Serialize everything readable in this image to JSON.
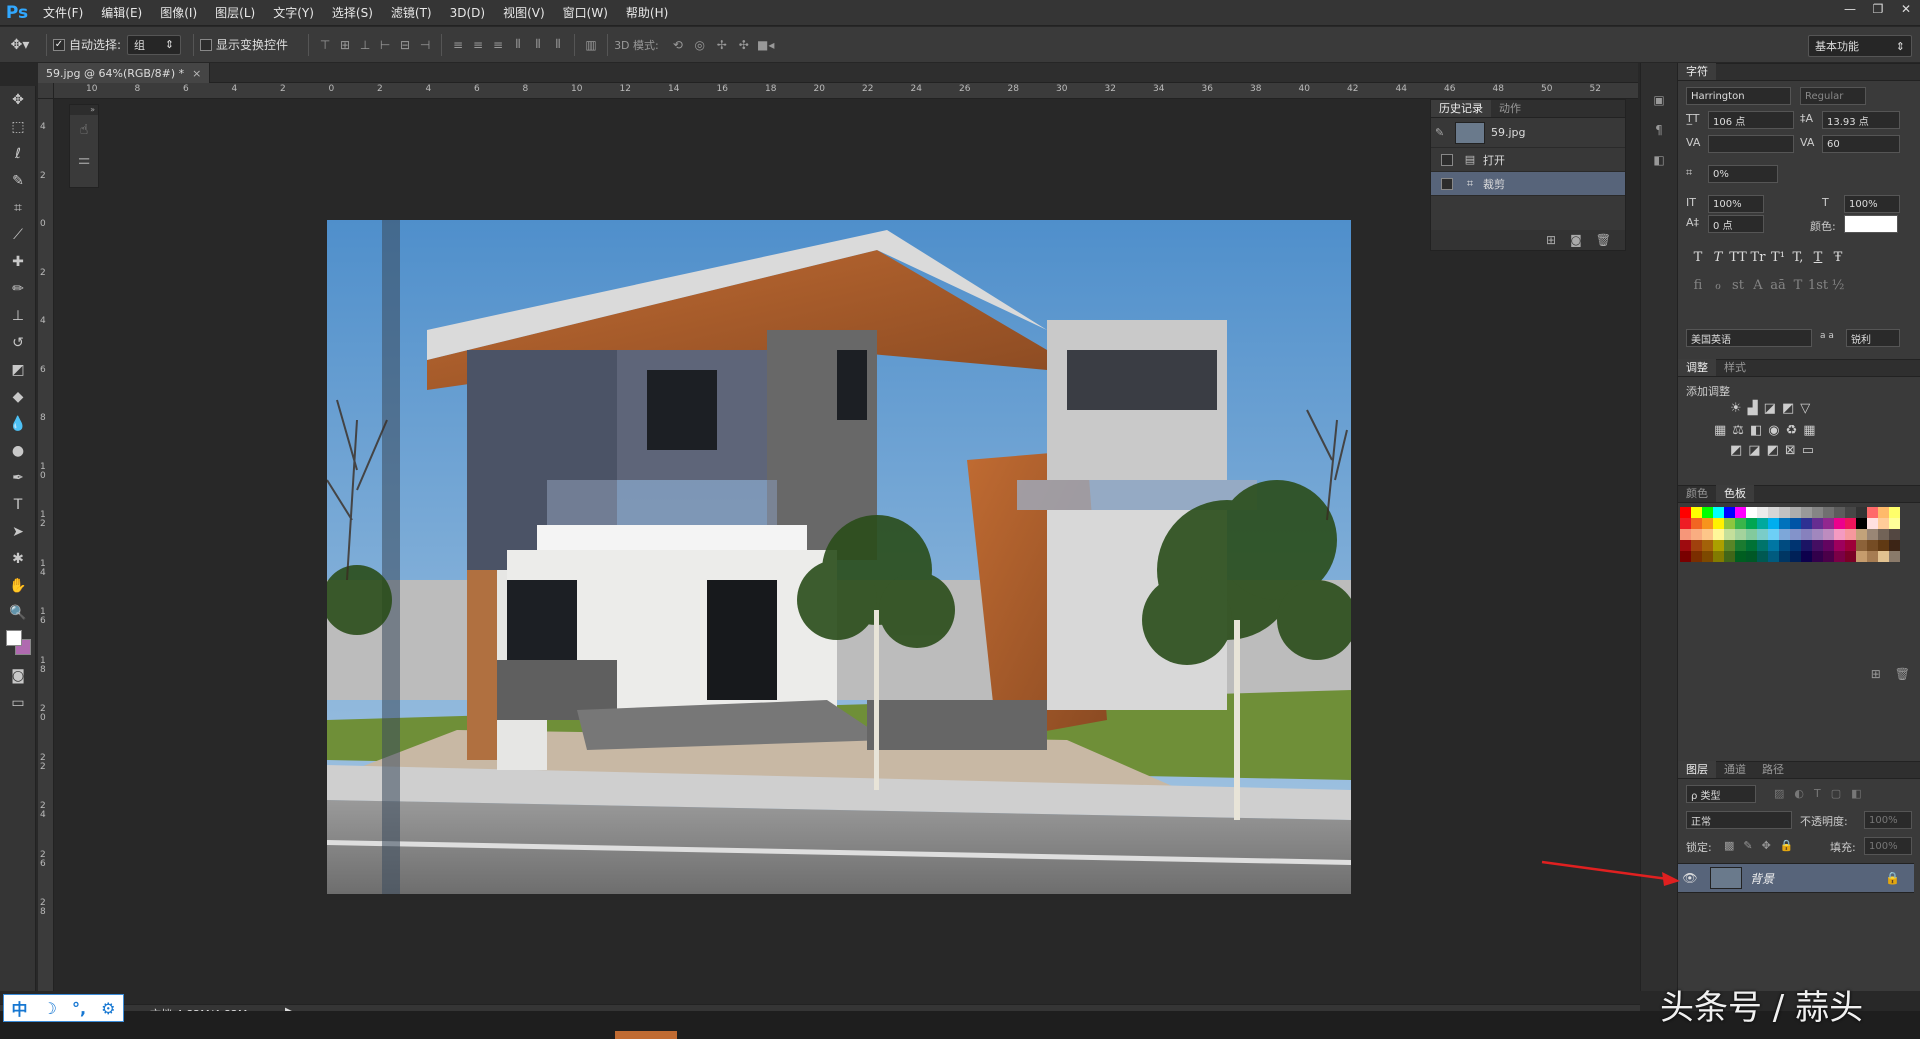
{
  "app": {
    "logo": "Ps"
  },
  "menu": [
    "文件(F)",
    "编辑(E)",
    "图像(I)",
    "图层(L)",
    "文字(Y)",
    "选择(S)",
    "滤镜(T)",
    "3D(D)",
    "视图(V)",
    "窗口(W)",
    "帮助(H)"
  ],
  "window_controls": [
    "—",
    "❐",
    "✕"
  ],
  "options_bar": {
    "auto_select_label": "自动选择:",
    "auto_select_value": "组",
    "show_transform_label": "显示变换控件",
    "mode_3d_label": "3D 模式:",
    "workspace": "基本功能"
  },
  "document": {
    "tab": "59.jpg @ 64%(RGB/8#) *",
    "tab_close": "×",
    "status": "文档:4.82M/4.82M"
  },
  "ruler_h": [
    "10",
    "8",
    "6",
    "4",
    "2",
    "0",
    "2",
    "4",
    "6",
    "8",
    "10",
    "12",
    "14",
    "16",
    "18",
    "20",
    "22",
    "24",
    "26",
    "28",
    "30",
    "32",
    "34",
    "36",
    "38",
    "40",
    "42",
    "44",
    "46",
    "48",
    "50",
    "52"
  ],
  "ruler_v": [
    "4",
    "2",
    "0",
    "2",
    "4",
    "6",
    "8",
    "1 0",
    "1 2",
    "1 4",
    "1 6",
    "1 8",
    "2 0",
    "2 2",
    "2 4",
    "2 6",
    "2 8"
  ],
  "history_panel": {
    "tabs": [
      "历史记录",
      "动作"
    ],
    "snapshot": "59.jpg",
    "items": [
      "打开",
      "裁剪"
    ]
  },
  "character_panel": {
    "tab": "字符",
    "font_family": "Harrington",
    "font_style": "Regular",
    "font_size": "106 点",
    "leading": "13.93 点",
    "kerning": "",
    "tracking": "60",
    "scale_pct": "0%",
    "vertical_scale": "100%",
    "horizontal_scale": "100%",
    "baseline_shift": "0 点",
    "color_label": "颜色:",
    "style_buttons": [
      "T",
      "T",
      "TT",
      "Tr",
      "T¹",
      "T,",
      "T",
      "Ŧ"
    ],
    "ot_buttons": [
      "fi",
      "ℴ",
      "st",
      "A",
      "aā",
      "T",
      "1st",
      "½"
    ],
    "language": "美国英语",
    "aa_label": "a a",
    "antialias": "锐利"
  },
  "adjustments_panel": {
    "tabs": [
      "调整",
      "样式"
    ],
    "title": "添加调整"
  },
  "swatches_panel": {
    "tabs": [
      "颜色",
      "色板"
    ],
    "colors": [
      "#ff0000",
      "#ffff00",
      "#00ff00",
      "#00ffff",
      "#0000ff",
      "#ff00ff",
      "#ffffff",
      "#ebebeb",
      "#d6d6d6",
      "#c2c2c2",
      "#adadad",
      "#999999",
      "#858585",
      "#707070",
      "#5c5c5c",
      "#474747",
      "#333333",
      "#ff6a6a",
      "#ffba6a",
      "#ffff6a",
      "#ee1d24",
      "#f26522",
      "#f7941d",
      "#fff200",
      "#8dc63f",
      "#39b54a",
      "#00a651",
      "#00a99d",
      "#00aeef",
      "#0072bc",
      "#0054a6",
      "#2e3192",
      "#662d91",
      "#92278f",
      "#ec008c",
      "#ed145b",
      "#000000",
      "#ffe0e0",
      "#ffcc99",
      "#ffff99",
      "#f69679",
      "#f9ad81",
      "#fdc689",
      "#fff799",
      "#c4df9b",
      "#a3d39c",
      "#82ca9c",
      "#7accc8",
      "#6dcff6",
      "#7da7d9",
      "#8393ca",
      "#8781bd",
      "#a187be",
      "#bd8cbf",
      "#f49ac1",
      "#f6989d",
      "#c2a37a",
      "#998675",
      "#726357",
      "#534741",
      "#9e0b0f",
      "#a0410d",
      "#a36209",
      "#aba000",
      "#598527",
      "#1a7b30",
      "#007236",
      "#00746b",
      "#0076a3",
      "#004b80",
      "#003471",
      "#1b1464",
      "#440e62",
      "#630460",
      "#9e005d",
      "#9e0039",
      "#8c6239",
      "#754c24",
      "#603913",
      "#3c2415",
      "#790000",
      "#7b2e00",
      "#7d4900",
      "#827b00",
      "#406618",
      "#005e20",
      "#005826",
      "#005952",
      "#005b7f",
      "#003663",
      "#002157",
      "#0d004c",
      "#32004b",
      "#4b0049",
      "#7b0046",
      "#7a0026",
      "#c69c6d",
      "#a67c52",
      "#e2c290",
      "#8a7a6a"
    ]
  },
  "layers_panel": {
    "tabs": [
      "图层",
      "通道",
      "路径"
    ],
    "filter_label": "ρ 类型",
    "blend_mode": "正常",
    "opacity_label": "不透明度:",
    "opacity": "100%",
    "lock_label": "锁定:",
    "fill_label": "填充:",
    "fill": "100%",
    "layers": [
      {
        "name": "背景",
        "visible": true,
        "locked": true
      }
    ]
  },
  "ime_bar": {
    "items": [
      "中",
      "☽",
      "°,",
      "⚙"
    ]
  },
  "watermark": "头条号 / 蒜头",
  "colors": {
    "accent_selection": "#57647a",
    "arrow": "#e02020",
    "ime_blue": "#1677d2"
  }
}
